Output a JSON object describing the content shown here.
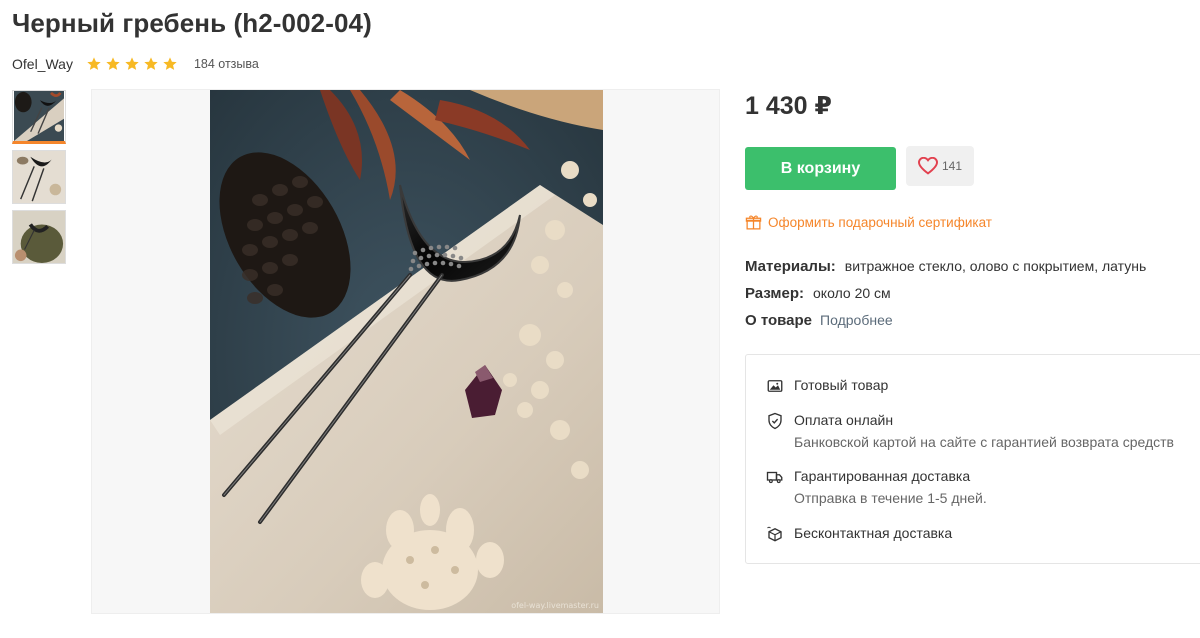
{
  "product": {
    "title": "Черный гребень (h2-002-04)",
    "seller": "Ofel_Way",
    "rating_stars": 5,
    "reviews": "184 отзыва",
    "price": "1 430 ₽",
    "image_watermark": "ofel-way.livemaster.ru"
  },
  "actions": {
    "cart_label": "В корзину",
    "fav_count": "141",
    "gift_label": "Оформить подарочный сертификат"
  },
  "attributes": {
    "materials_key": "Материалы:",
    "materials_value": "витражное стекло, олово с покрытием, латунь",
    "size_key": "Размер:",
    "size_value": "около 20 см",
    "about_key": "О товаре",
    "about_link": "Подробнее"
  },
  "info": {
    "ready_title": "Готовый товар",
    "payment_title": "Оплата онлайн",
    "payment_sub": "Банковской картой на сайте с гарантией возврата средств",
    "delivery_title": "Гарантированная доставка",
    "delivery_sub": "Отправка в течение 1-5 дней.",
    "contactless_title": "Бесконтактная доставка"
  },
  "colors": {
    "accent_orange": "#f5862b",
    "cart_green": "#3cbf6c",
    "star_gold": "#f7b924",
    "heart_red": "#e2414f"
  },
  "icons": [
    "star-icon",
    "heart-icon",
    "gift-icon",
    "image-icon",
    "shield-check-icon",
    "truck-icon",
    "contactless-box-icon"
  ]
}
